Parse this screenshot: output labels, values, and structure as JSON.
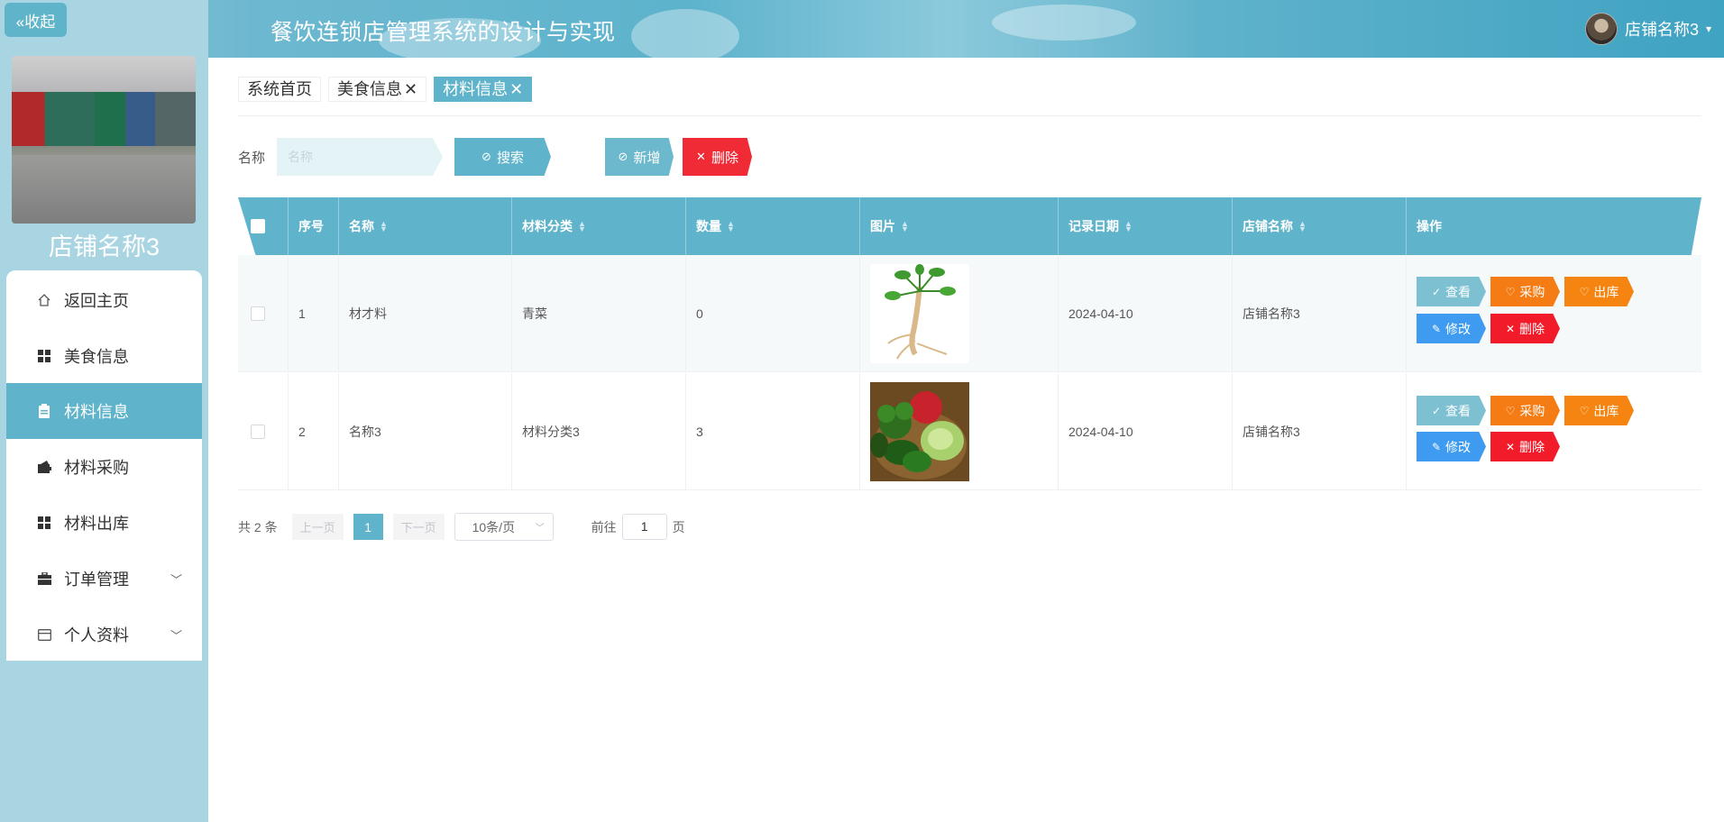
{
  "header": {
    "title": "餐饮连锁店管理系统的设计与实现",
    "user_name": "店铺名称3"
  },
  "sidebar": {
    "collapse_label": "«收起",
    "shop_name": "店铺名称3",
    "items": [
      {
        "label": "返回主页",
        "icon": "home-icon"
      },
      {
        "label": "美食信息",
        "icon": "grid-icon"
      },
      {
        "label": "材料信息",
        "icon": "clipboard-icon",
        "active": true
      },
      {
        "label": "材料采购",
        "icon": "wallet-icon"
      },
      {
        "label": "材料出库",
        "icon": "grid-icon"
      },
      {
        "label": "订单管理",
        "icon": "briefcase-icon",
        "expandable": true
      },
      {
        "label": "个人资料",
        "icon": "card-icon",
        "expandable": true
      }
    ]
  },
  "tabs": [
    {
      "label": "系统首页",
      "closable": false
    },
    {
      "label": "美食信息",
      "closable": true
    },
    {
      "label": "材料信息",
      "closable": true,
      "active": true
    }
  ],
  "search": {
    "label": "名称",
    "placeholder": "名称",
    "search_button": "搜索",
    "add_button": "新增",
    "delete_button": "删除"
  },
  "table": {
    "columns": [
      "序号",
      "名称",
      "材料分类",
      "数量",
      "图片",
      "记录日期",
      "店铺名称",
      "操作"
    ],
    "rows": [
      {
        "index": "1",
        "name": "材才料",
        "category": "青菜",
        "quantity": "0",
        "image": "ginseng",
        "date": "2024-04-10",
        "shop": "店铺名称3"
      },
      {
        "index": "2",
        "name": "名称3",
        "category": "材料分类3",
        "quantity": "3",
        "image": "vegetables",
        "date": "2024-04-10",
        "shop": "店铺名称3"
      }
    ],
    "actions": {
      "view": "查看",
      "purchase": "采购",
      "outbound": "出库",
      "edit": "修改",
      "delete": "删除"
    }
  },
  "pagination": {
    "total_text": "共 2 条",
    "prev": "上一页",
    "current_page": "1",
    "next": "下一页",
    "page_size": "10条/页",
    "goto_label": "前往",
    "goto_value": "1",
    "page_unit": "页"
  },
  "colors": {
    "primary": "#5fb3ca",
    "danger": "#f12b36",
    "warning": "#f57c14",
    "info": "#3e9bf0"
  }
}
